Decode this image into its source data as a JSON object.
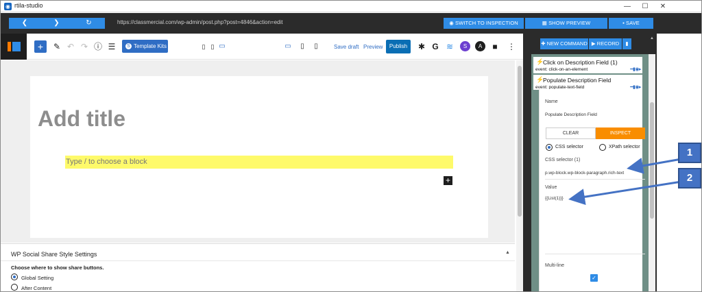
{
  "window": {
    "title": "rtila-studio",
    "app_icon": "rtila-icon",
    "controls": [
      "—",
      "☐",
      "✕"
    ]
  },
  "browser": {
    "back_icon": "❮",
    "forward_icon": "❯",
    "reload_icon": "↻",
    "url": "https://classmercial.com/wp-admin/post.php?post=4846&action=edit",
    "switch_label": "SWITCH TO INSPECTION",
    "preview_label": "SHOW PREVIEW",
    "save_label": "SAVE"
  },
  "toolbar": {
    "plus": "+",
    "template_kits_label": "Template Kits",
    "save_draft_label": "Save draft",
    "preview_label": "Preview",
    "publish_label": "Publish"
  },
  "canvas": {
    "title_placeholder": "Add title",
    "block_placeholder": "Type / to choose a block",
    "inserter": "+"
  },
  "settings": {
    "title": "WP Social Share Style Settings",
    "question": "Choose where to show share buttons.",
    "options": [
      "Global Setting",
      "After Content"
    ]
  },
  "right_panel": {
    "new_command_label": "NEW COMMAND",
    "record_label": "RECORD",
    "commands": [
      {
        "title": "Click on Description Field (1)",
        "event": "event:  click-on-an-element"
      },
      {
        "title": "Populate Description Field",
        "event": "event:  populate-text-field"
      }
    ],
    "form": {
      "name_label": "Name",
      "name_value": "Populate Description Field",
      "clear_label": "CLEAR",
      "inspect_label": "INSPECT",
      "css_option": "CSS selector",
      "xpath_option": "XPath selector",
      "selector_label": "CSS selector (1)",
      "selector_value": "p.wp-block.wp-block-paragraph.rich-text",
      "value_label": "Value",
      "value_value": "{{List(1)}}",
      "multiline_label": "Multi-line"
    }
  },
  "annotations": {
    "badge1": "1",
    "badge2": "2"
  },
  "colors": {
    "accent": "#2f8ce6",
    "inspect": "#f98d00",
    "highlight": "#fefa6a",
    "panel_dark": "#2b2b2b",
    "command_list_bg": "#6f8f86",
    "annotation": "#4472c4"
  }
}
